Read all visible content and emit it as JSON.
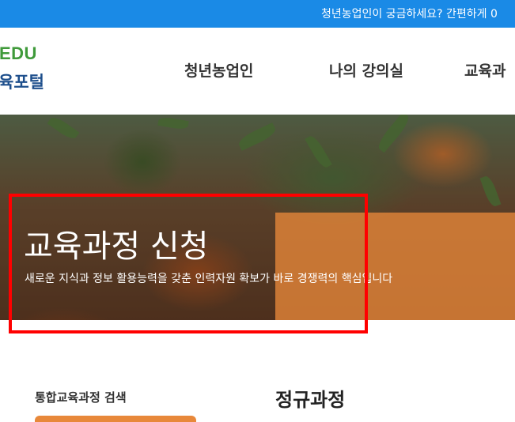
{
  "topbar": {
    "notice": "청년농업인이 궁금하세요? 간편하게 0"
  },
  "header": {
    "logo_top": "EDU",
    "logo_bottom": "육포털",
    "nav": [
      "청년농업인",
      "나의 강의실",
      "교육과"
    ]
  },
  "hero": {
    "title": "교육과정 신청",
    "subtitle": "새로운 지식과 정보 활용능력을 갖춘 인력자원 확보가 바로 경쟁력의 핵심입니다"
  },
  "sidebar": {
    "search_title": "통합교육과정 검색"
  },
  "main": {
    "section_title": "정규과정"
  },
  "colors": {
    "topbar": "#1a8ae6",
    "logo_green": "#3f9a3a",
    "logo_blue": "#1e4f8c",
    "accent_orange": "#e8883a",
    "highlight": "#ff0000"
  }
}
